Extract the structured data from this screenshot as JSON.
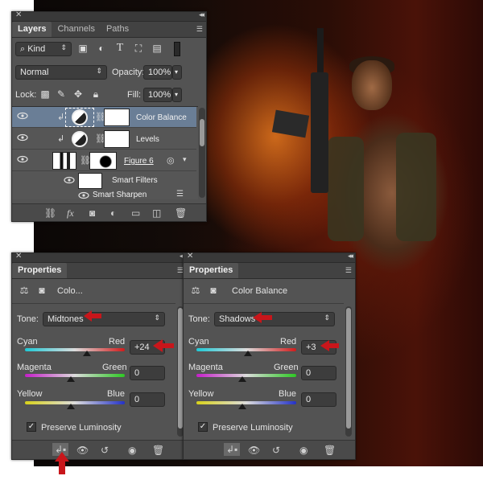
{
  "layers_panel": {
    "tabs": [
      "Layers",
      "Channels",
      "Paths"
    ],
    "filter_kind": "Kind",
    "blend_mode": "Normal",
    "opacity_label": "Opacity:",
    "opacity_value": "100%",
    "lock_label": "Lock:",
    "fill_label": "Fill:",
    "fill_value": "100%",
    "layers": [
      {
        "name": "Color Balance",
        "selected": true
      },
      {
        "name": "Levels",
        "selected": false
      },
      {
        "name": "Figure 6",
        "selected": false
      },
      {
        "name": "Smart Filters",
        "selected": false
      },
      {
        "name": "Smart Sharpen",
        "selected": false
      }
    ]
  },
  "properties_left": {
    "tab": "Properties",
    "header_title": "Colo...",
    "tone_label": "Tone:",
    "tone_value": "Midtones",
    "cyan_label": "Cyan",
    "red_label": "Red",
    "cyan_red_value": "+24",
    "cyan_red_fraction": 0.62,
    "magenta_label": "Magenta",
    "green_label": "Green",
    "magenta_green_value": "0",
    "yellow_label": "Yellow",
    "blue_label": "Blue",
    "yellow_blue_value": "0",
    "preserve_label": "Preserve Luminosity"
  },
  "properties_right": {
    "tab": "Properties",
    "header_title": "Color Balance",
    "tone_label": "Tone:",
    "tone_value": "Shadows",
    "cyan_label": "Cyan",
    "red_label": "Red",
    "cyan_red_value": "+3",
    "cyan_red_fraction": 0.52,
    "magenta_label": "Magenta",
    "green_label": "Green",
    "magenta_green_value": "0",
    "yellow_label": "Yellow",
    "blue_label": "Blue",
    "yellow_blue_value": "0",
    "preserve_label": "Preserve Luminosity"
  },
  "colors": {
    "annotation_arrow": "#c8161b",
    "selected_layer": "#6a7e96"
  }
}
